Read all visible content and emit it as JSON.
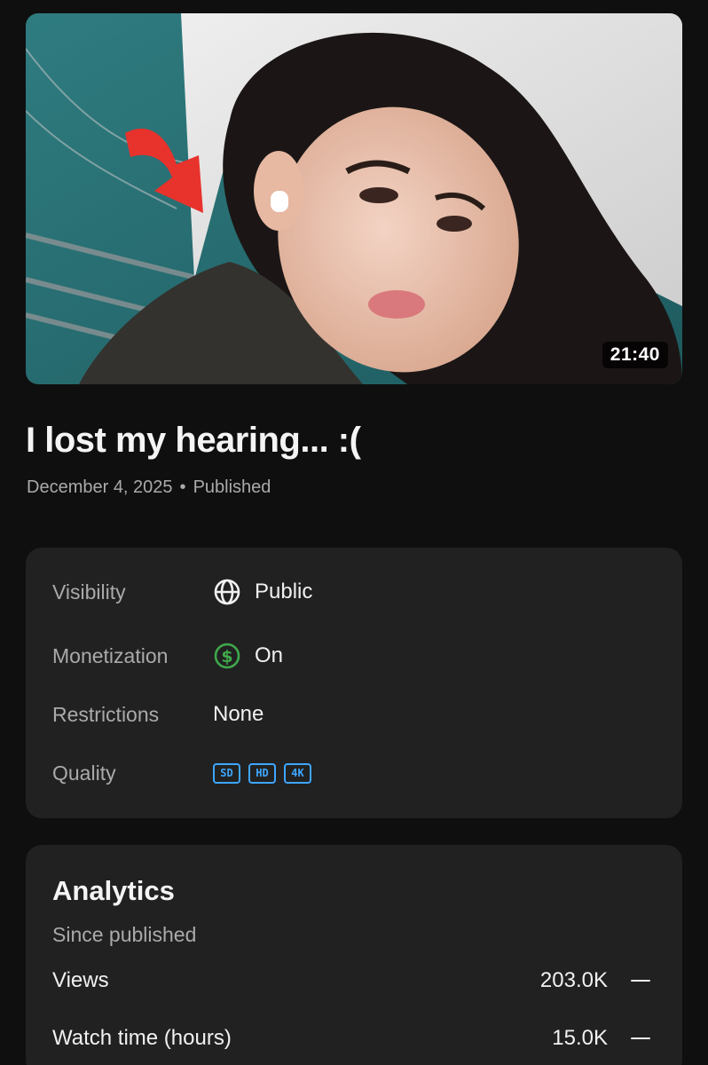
{
  "video": {
    "duration": "21:40",
    "title": "I lost my hearing... :(",
    "date": "December 4, 2025",
    "separator": "•",
    "status": "Published"
  },
  "details": {
    "visibility": {
      "label": "Visibility",
      "value": "Public",
      "icon": "globe-icon"
    },
    "monetization": {
      "label": "Monetization",
      "value": "On",
      "icon": "dollar-circle-icon",
      "icon_color": "#3fa84a"
    },
    "restrictions": {
      "label": "Restrictions",
      "value": "None"
    },
    "quality": {
      "label": "Quality",
      "badges": [
        "SD",
        "HD",
        "4K"
      ],
      "badge_color": "#3ea6ff"
    }
  },
  "analytics": {
    "title": "Analytics",
    "subtitle": "Since published",
    "metrics": [
      {
        "name": "Views",
        "value": "203.0K",
        "trend": "flat"
      },
      {
        "name": "Watch time (hours)",
        "value": "15.0K",
        "trend": "flat"
      }
    ]
  },
  "colors": {
    "background": "#0f0f0f",
    "card": "#212121",
    "arrow": "#e8322c"
  }
}
